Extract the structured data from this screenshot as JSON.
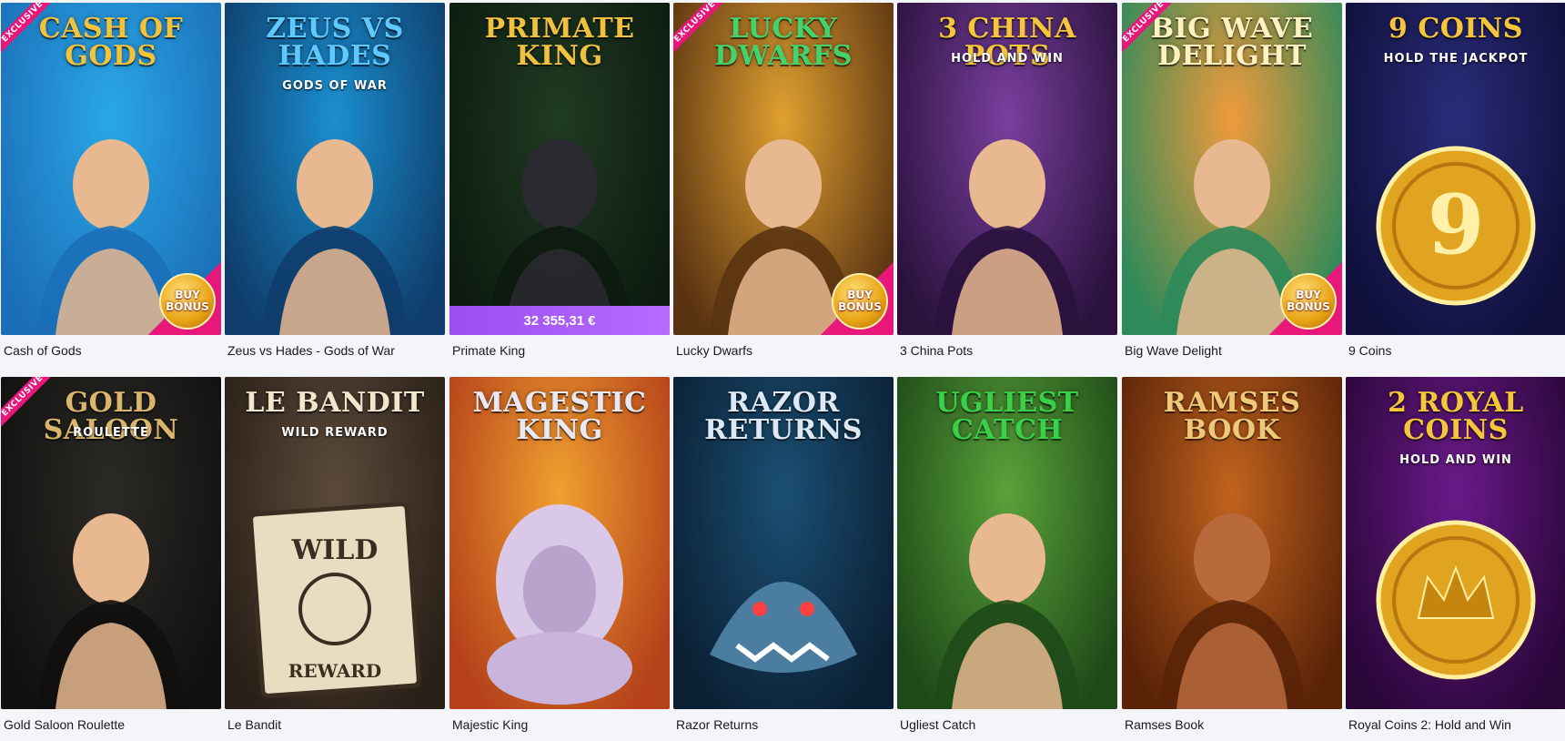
{
  "games": [
    {
      "name": "Cash of Gods",
      "art_title": "CASH OF GODS",
      "art_sub": "",
      "exclusive": "EXCLUSIVE",
      "bonus": "BUY BONUS",
      "jackpot": "",
      "colors": [
        "#2aa7e6",
        "#1b6fb8"
      ],
      "title_color": "#f3c23a",
      "figure": "zeus-icon"
    },
    {
      "name": "Zeus vs Hades - Gods of War",
      "art_title": "ZEUS VS HADES",
      "art_sub": "GODS OF WAR",
      "exclusive": "",
      "bonus": "",
      "jackpot": "",
      "colors": [
        "#1a8fd0",
        "#0f3d6b"
      ],
      "title_color": "#5ec8ff",
      "figure": "hades-icon"
    },
    {
      "name": "Primate King",
      "art_title": "PRIMATE KING",
      "art_sub": "",
      "exclusive": "",
      "bonus": "",
      "jackpot": "32 355,31 €",
      "colors": [
        "#1f3b22",
        "#0d1a10"
      ],
      "title_color": "#f0c040",
      "figure": "gorilla-icon"
    },
    {
      "name": "Lucky Dwarfs",
      "art_title": "LUCKY DWARFS",
      "art_sub": "",
      "exclusive": "EXCLUSIVE",
      "bonus": "BUY BONUS",
      "jackpot": "",
      "colors": [
        "#e0a030",
        "#5a3412"
      ],
      "title_color": "#43d36b",
      "figure": "dwarf-icon"
    },
    {
      "name": "3 China Pots",
      "art_title": "3 CHINA POTS",
      "art_sub": "HOLD AND WIN",
      "exclusive": "",
      "bonus": "",
      "jackpot": "",
      "colors": [
        "#7a3f9e",
        "#2a123d"
      ],
      "title_color": "#f5c63a",
      "figure": "empress-icon"
    },
    {
      "name": "Big Wave Delight",
      "art_title": "BIG WAVE DELIGHT",
      "art_sub": "",
      "exclusive": "EXCLUSIVE",
      "bonus": "BUY BONUS",
      "jackpot": "",
      "colors": [
        "#f09a3c",
        "#2e8a5a"
      ],
      "title_color": "#fff2c0",
      "figure": "surfers-icon"
    },
    {
      "name": "9 Coins",
      "art_title": "9 COINS",
      "art_sub": "HOLD THE JACKPOT",
      "exclusive": "",
      "bonus": "",
      "jackpot": "",
      "colors": [
        "#2a2c7a",
        "#0f0f3a"
      ],
      "title_color": "#f5c63a",
      "figure": "coin-icon"
    },
    {
      "name": "Gold Saloon Roulette",
      "art_title": "GOLD SALOON",
      "art_sub": "ROULETTE",
      "exclusive": "EXCLUSIVE",
      "bonus": "",
      "jackpot": "",
      "colors": [
        "#2b2a26",
        "#11100e"
      ],
      "title_color": "#d9b66b",
      "figure": "dealer-icon"
    },
    {
      "name": "Le Bandit",
      "art_title": "LE BANDIT",
      "art_sub": "WILD REWARD",
      "exclusive": "",
      "bonus": "",
      "jackpot": "",
      "colors": [
        "#5b4a3a",
        "#2a2018"
      ],
      "title_color": "#f2e6cc",
      "figure": "poster-icon"
    },
    {
      "name": "Majestic King",
      "art_title": "MAGESTIC KING",
      "art_sub": "",
      "exclusive": "",
      "bonus": "",
      "jackpot": "",
      "colors": [
        "#f0a030",
        "#b5401a"
      ],
      "title_color": "#e9e9f5",
      "figure": "lion-icon"
    },
    {
      "name": "Razor Returns",
      "art_title": "RAZOR RETURNS",
      "art_sub": "",
      "exclusive": "",
      "bonus": "",
      "jackpot": "",
      "colors": [
        "#1b4f73",
        "#0a1f33"
      ],
      "title_color": "#dde8f5",
      "figure": "shark-icon"
    },
    {
      "name": "Ugliest Catch",
      "art_title": "UGLIEST CATCH",
      "art_sub": "",
      "exclusive": "",
      "bonus": "",
      "jackpot": "",
      "colors": [
        "#5aa23a",
        "#1e4a18"
      ],
      "title_color": "#39d04a",
      "figure": "fisherman-icon"
    },
    {
      "name": "Ramses Book",
      "art_title": "RAMSES BOOK",
      "art_sub": "",
      "exclusive": "",
      "bonus": "",
      "jackpot": "",
      "colors": [
        "#c2631e",
        "#5a2308"
      ],
      "title_color": "#f0c87a",
      "figure": "pharaoh-icon"
    },
    {
      "name": "Royal Coins 2: Hold and Win",
      "art_title": "2 ROYAL COINS",
      "art_sub": "HOLD AND WIN",
      "exclusive": "",
      "bonus": "",
      "jackpot": "",
      "colors": [
        "#6a1a8a",
        "#2a0638"
      ],
      "title_color": "#f5c63a",
      "figure": "crown-coin-icon"
    }
  ]
}
